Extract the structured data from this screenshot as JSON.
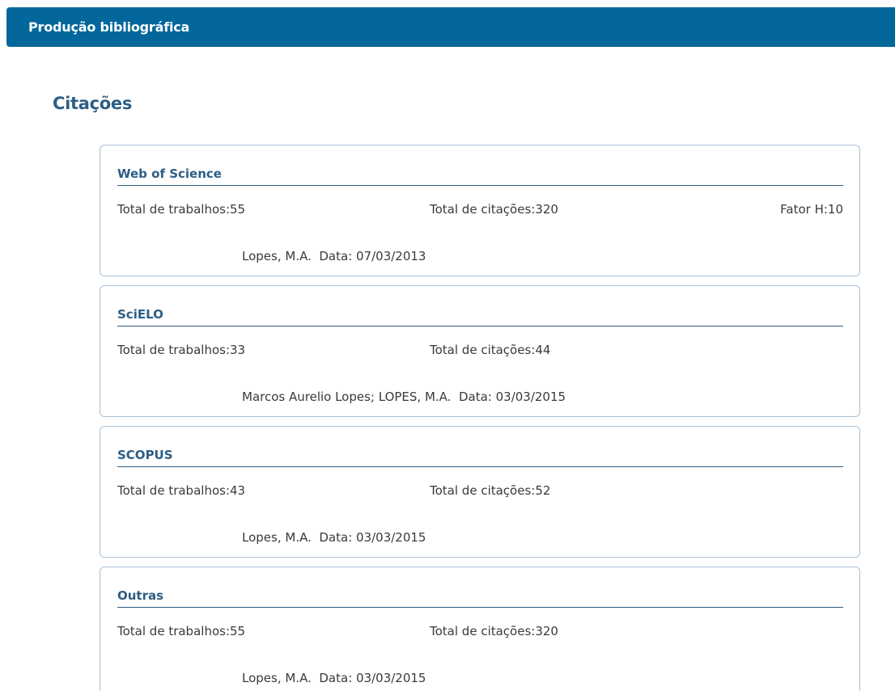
{
  "header": {
    "title": "Produção bibliográfica"
  },
  "section": {
    "title": "Citações"
  },
  "cards": [
    {
      "title": "Web of Science",
      "works": "Total de trabalhos:55",
      "citations": "Total de citações:320",
      "h_index": "Fator H:10",
      "source": "Lopes, M.A.  Data: 07/03/2013"
    },
    {
      "title": "SciELO",
      "works": "Total de trabalhos:33",
      "citations": "Total de citações:44",
      "source": "Marcos Aurelio Lopes; LOPES, M.A.  Data: 03/03/2015"
    },
    {
      "title": "SCOPUS",
      "works": "Total de trabalhos:43",
      "citations": "Total de citações:52",
      "source": "Lopes, M.A.  Data: 03/03/2015"
    },
    {
      "title": "Outras",
      "works": "Total de trabalhos:55",
      "citations": "Total de citações:320",
      "source": "Lopes, M.A.  Data: 03/03/2015"
    }
  ]
}
